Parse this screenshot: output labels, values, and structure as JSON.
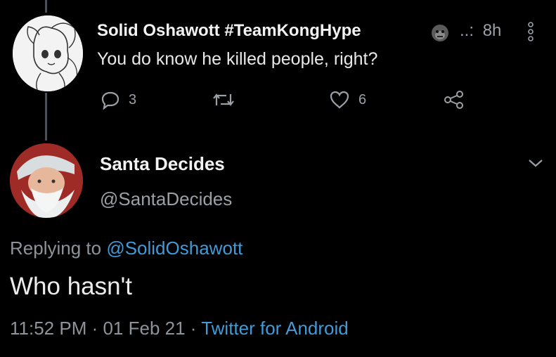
{
  "reply_tweet": {
    "display_name": "Solid Oshawott #TeamKongHype",
    "name_emoji": "gorilla-emoji",
    "name_suffix": "..:",
    "time_ago": "8h",
    "text": "You do know he killed people, right?",
    "reply_count": "3",
    "like_count": "6"
  },
  "main_tweet": {
    "display_name": "Santa Decides",
    "handle": "@SantaDecides",
    "replying_prefix": "Replying to",
    "replying_to": "@SolidOshawott",
    "text": "Who hasn't",
    "timestamp": "11:52 PM · 01 Feb 21 ·",
    "client": "Twitter for Android"
  },
  "colors": {
    "background": "#000000",
    "link": "#3f9bd9",
    "muted": "#8d9399"
  }
}
